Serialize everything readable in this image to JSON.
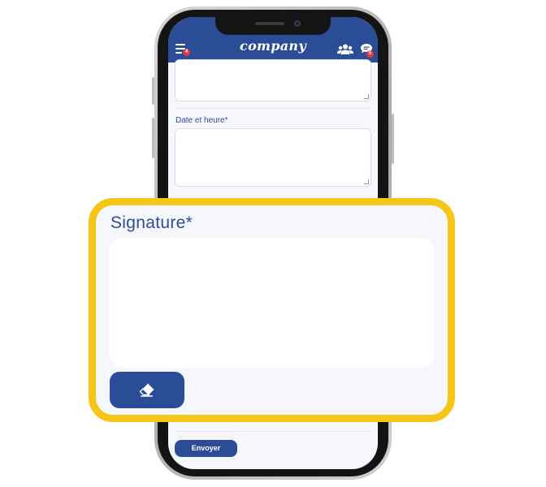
{
  "app": {
    "brand_name": "company",
    "menu_badge_count": "4",
    "chat_badge_count": "5"
  },
  "form": {
    "date_label": "Date et heure*",
    "signature_label": "Signature*",
    "submit_label": "Envoyer"
  },
  "icons": {
    "menu": "hamburger-menu-icon",
    "users": "users-group-icon",
    "chat": "chat-bubble-icon",
    "eraser": "eraser-icon"
  },
  "colors": {
    "primary": "#2b4d98",
    "highlight": "#f5c518",
    "badge": "#e53935",
    "background": "#f5f7fc"
  }
}
